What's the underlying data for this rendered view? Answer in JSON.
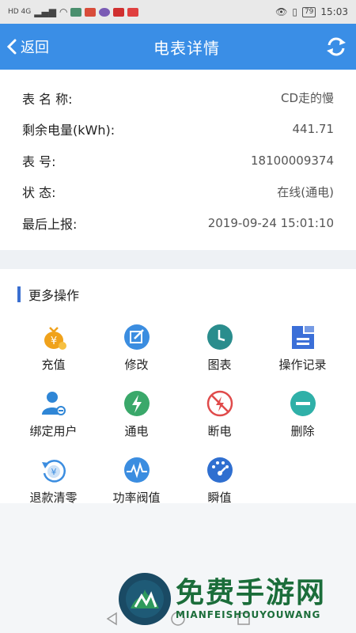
{
  "status": {
    "network": "HD 4G",
    "battery": "79",
    "time": "15:03"
  },
  "header": {
    "back_label": "返回",
    "title": "电表详情",
    "refresh_icon": "refresh-icon"
  },
  "info": {
    "name_label": "表 名 称:",
    "name_value": "CD走的慢",
    "remaining_label": "剩余电量(kWh):",
    "remaining_value": "441.71",
    "number_label": "表 号:",
    "number_value": "18100009374",
    "status_label": "状 态:",
    "status_value": "在线(通电)",
    "report_label": "最后上报:",
    "report_value": "2019-09-24 15:01:10"
  },
  "ops": {
    "title": "更多操作",
    "items": [
      {
        "label": "充值",
        "icon": "recharge-icon",
        "color": "#f0a21b"
      },
      {
        "label": "修改",
        "icon": "edit-icon",
        "color": "#3b8de0"
      },
      {
        "label": "图表",
        "icon": "chart-clock-icon",
        "color": "#2a8d8d"
      },
      {
        "label": "操作记录",
        "icon": "record-icon",
        "color": "#3b6fd8"
      },
      {
        "label": "绑定用户",
        "icon": "bind-user-icon",
        "color": "#2f86d6"
      },
      {
        "label": "通电",
        "icon": "power-on-icon",
        "color": "#3aa86a"
      },
      {
        "label": "断电",
        "icon": "power-off-icon",
        "color": "#e04b4b"
      },
      {
        "label": "删除",
        "icon": "delete-icon",
        "color": "#2fb0a8"
      },
      {
        "label": "退款清零",
        "icon": "refund-icon",
        "color": "#3b8de0"
      },
      {
        "label": "功率阀值",
        "icon": "power-threshold-icon",
        "color": "#3b8de0"
      },
      {
        "label": "瞬值",
        "icon": "instant-value-icon",
        "color": "#2f6fd0"
      }
    ]
  },
  "watermark": {
    "title": "免费手游网",
    "subtitle": "MIANFEISHOUYOUWANG"
  }
}
